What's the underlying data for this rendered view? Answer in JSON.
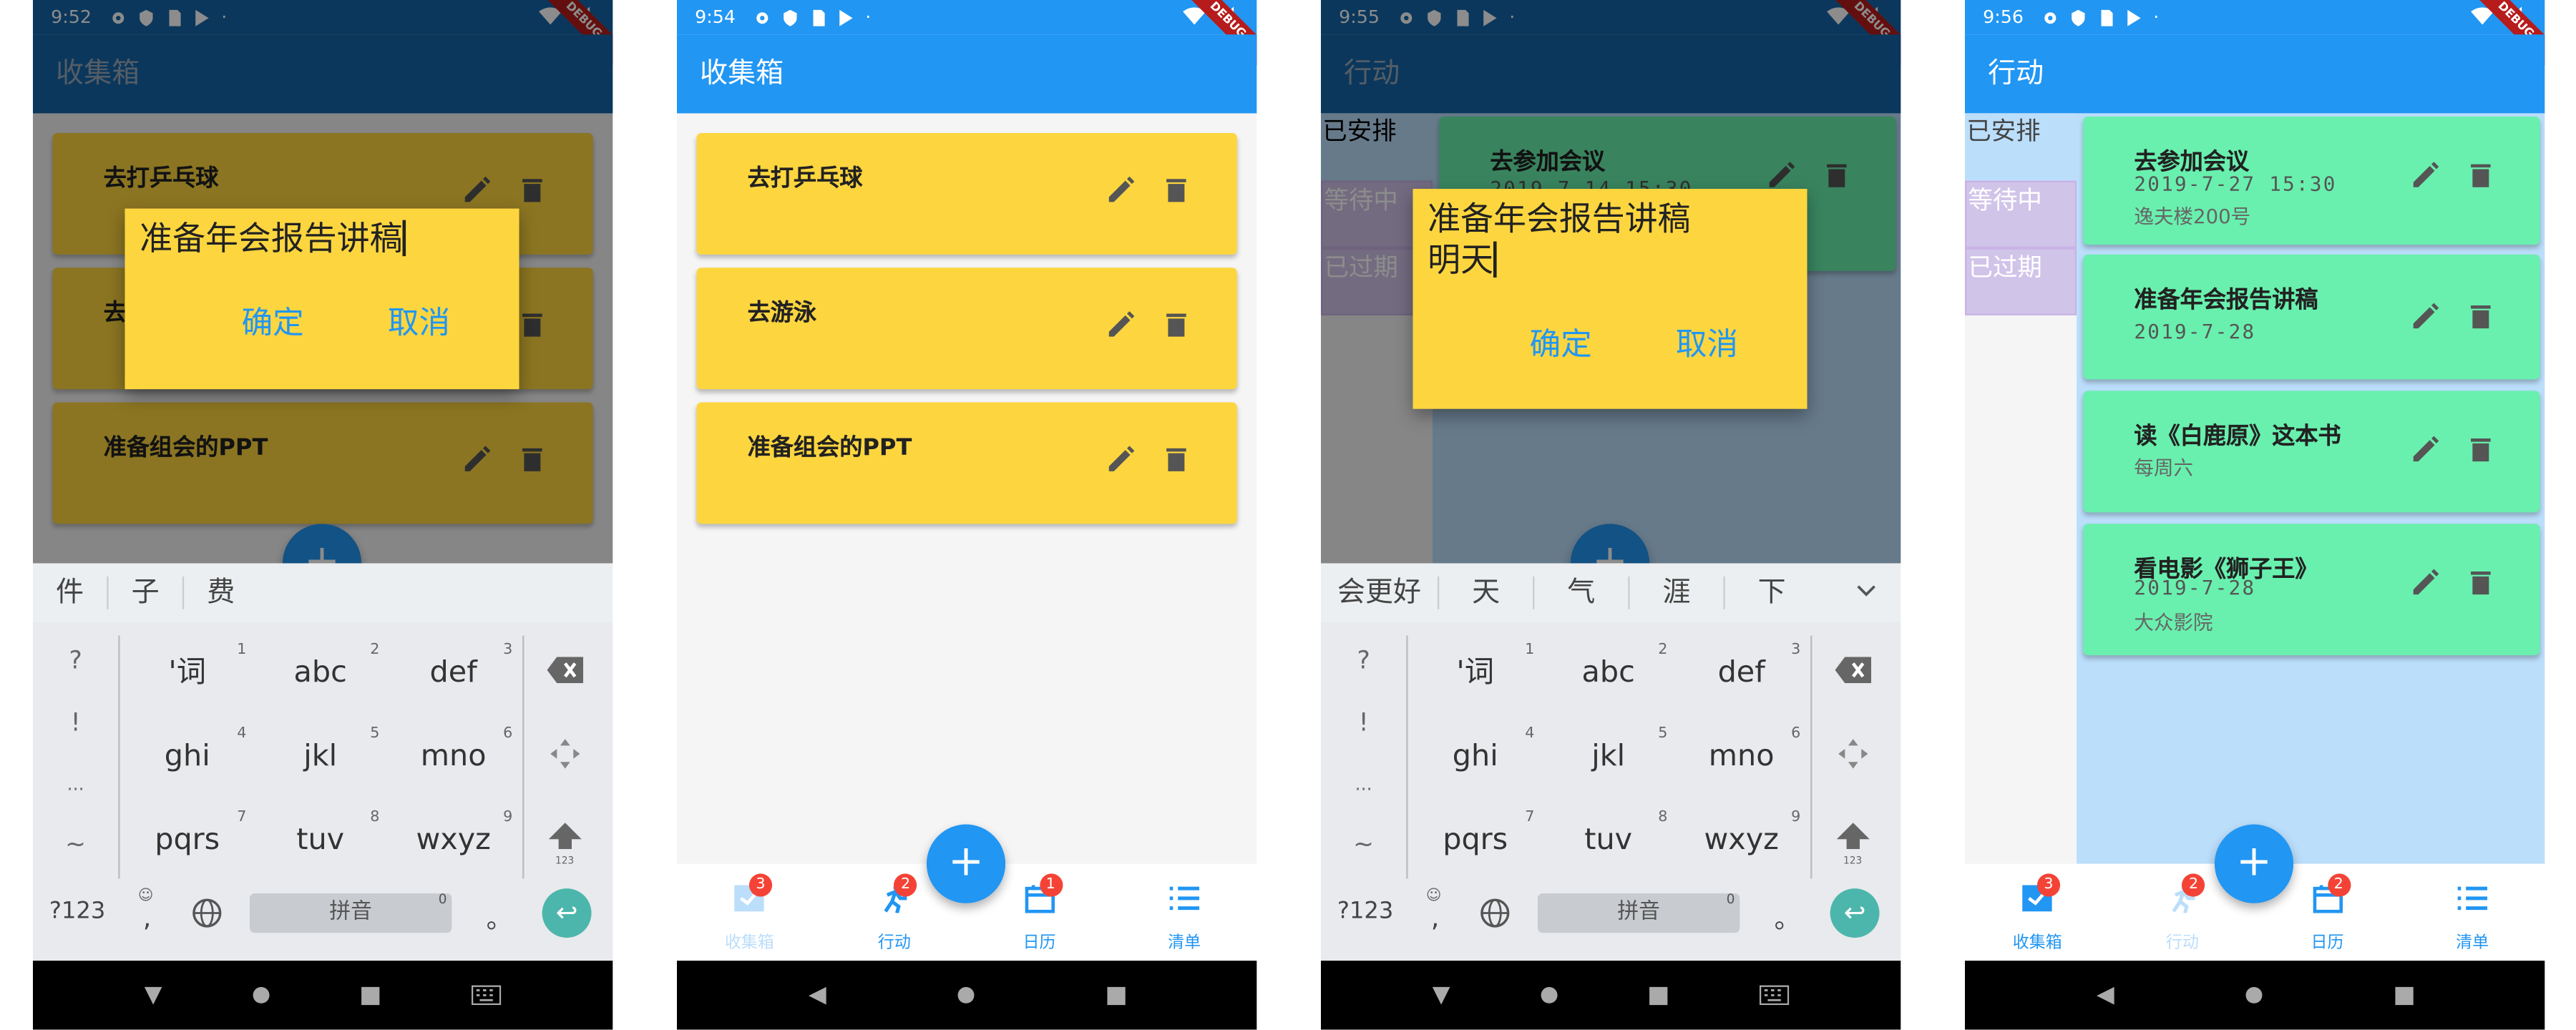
{
  "colors": {
    "primary": "#2196f3",
    "card_yellow": "#fdd63f",
    "card_green": "#69f0ae",
    "badge": "#f44336",
    "side_blue": "#bbdefb",
    "side_purple": "#d1c4e9",
    "keyboard_bg": "#e8eaed"
  },
  "screens": [
    {
      "time": "9:52",
      "debug": "DEBUG",
      "title": "收集箱",
      "cards": [
        {
          "title": "去打乒乓球"
        },
        {
          "title": "去"
        },
        {
          "title": "准备组会的PPT"
        }
      ],
      "fab": "+",
      "dialog": {
        "text": "准备年会报告讲稿",
        "ok": "确定",
        "cancel": "取消"
      },
      "candidates": [
        "件",
        "子",
        "费"
      ],
      "keyboard": {
        "left": [
          "?",
          "!",
          "...",
          "~"
        ],
        "rows": [
          [
            {
              "l": "'词",
              "n": "1"
            },
            {
              "l": "abc",
              "n": "2"
            },
            {
              "l": "def",
              "n": "3"
            }
          ],
          [
            {
              "l": "ghi",
              "n": "4"
            },
            {
              "l": "jkl",
              "n": "5"
            },
            {
              "l": "mno",
              "n": "6"
            }
          ],
          [
            {
              "l": "pqrs",
              "n": "7"
            },
            {
              "l": "tuv",
              "n": "8"
            },
            {
              "l": "wxyz",
              "n": "9"
            }
          ]
        ],
        "sym": "?123",
        "comma": ",",
        "space": "拼音",
        "space_num": "0",
        "period": "。",
        "key123": "123"
      }
    },
    {
      "time": "9:54",
      "debug": "DEBUG",
      "title": "收集箱",
      "cards": [
        {
          "title": "去打乒乓球"
        },
        {
          "title": "去游泳"
        },
        {
          "title": "准备组会的PPT"
        }
      ],
      "fab": "+",
      "nav": [
        {
          "label": "收集箱",
          "badge": "3",
          "active": true
        },
        {
          "label": "行动",
          "badge": "2",
          "active": false
        },
        {
          "label": "日历",
          "badge": "1",
          "active": false
        },
        {
          "label": "清单",
          "badge": "",
          "active": false
        }
      ]
    },
    {
      "time": "9:55",
      "debug": "DEBUG",
      "title": "行动",
      "side": [
        "已安排",
        "等待中",
        "已过期"
      ],
      "cards": [
        {
          "title": "去参加会议",
          "sub": "2019-7-14 15:30"
        }
      ],
      "fab": "+",
      "dialog": {
        "text": "准备年会报告讲稿",
        "text2": "明天",
        "ok": "确定",
        "cancel": "取消"
      },
      "candidates": [
        "会更好",
        "天",
        "气",
        "涯",
        "下"
      ],
      "keyboard": {
        "left": [
          "?",
          "!",
          "...",
          "~"
        ],
        "rows": [
          [
            {
              "l": "'词",
              "n": "1"
            },
            {
              "l": "abc",
              "n": "2"
            },
            {
              "l": "def",
              "n": "3"
            }
          ],
          [
            {
              "l": "ghi",
              "n": "4"
            },
            {
              "l": "jkl",
              "n": "5"
            },
            {
              "l": "mno",
              "n": "6"
            }
          ],
          [
            {
              "l": "pqrs",
              "n": "7"
            },
            {
              "l": "tuv",
              "n": "8"
            },
            {
              "l": "wxyz",
              "n": "9"
            }
          ]
        ],
        "sym": "?123",
        "comma": ",",
        "space": "拼音",
        "space_num": "0",
        "period": "。",
        "key123": "123"
      }
    },
    {
      "time": "9:56",
      "debug": "DEBUG",
      "title": "行动",
      "side": [
        "已安排",
        "等待中",
        "已过期"
      ],
      "cards": [
        {
          "title": "去参加会议",
          "sub": "2019-7-27 15:30",
          "sub2": "逸夫楼200号"
        },
        {
          "title": "准备年会报告讲稿",
          "sub": "2019-7-28"
        },
        {
          "title": "读《白鹿原》这本书",
          "sub2": "每周六"
        },
        {
          "title": "看电影《狮子王》",
          "sub": "2019-7-28",
          "sub2": "大众影院"
        }
      ],
      "fab": "+",
      "nav": [
        {
          "label": "收集箱",
          "badge": "3",
          "active": false
        },
        {
          "label": "行动",
          "badge": "2",
          "active": true
        },
        {
          "label": "日历",
          "badge": "2",
          "active": false
        },
        {
          "label": "清单",
          "badge": "",
          "active": false
        }
      ]
    }
  ]
}
